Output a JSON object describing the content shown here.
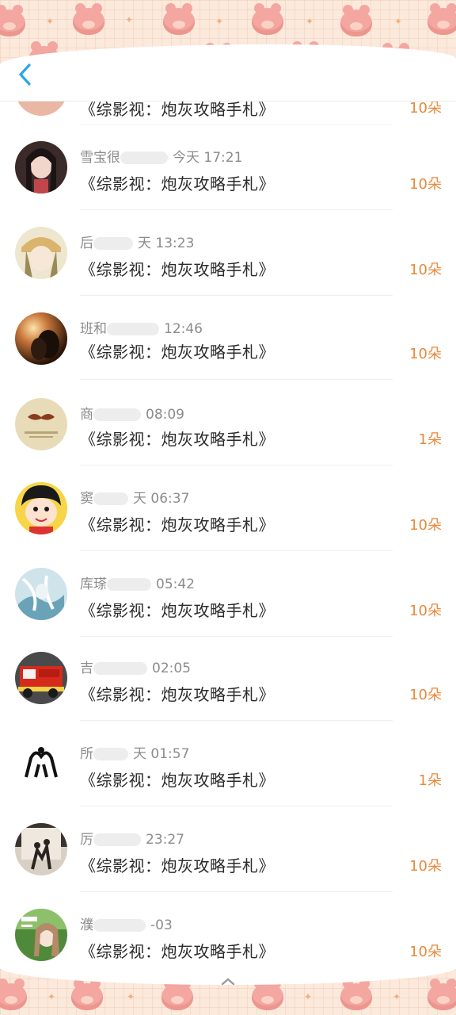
{
  "header": {
    "back_icon": "chevron-left-icon",
    "accent_color": "#2ba6e6"
  },
  "rows": [
    {
      "name": "",
      "time": "",
      "title": "《综影视：炮灰攻略手札》",
      "amount": "10朵"
    },
    {
      "name": "雪宝很",
      "time": "今天 17:21",
      "title": "《综影视：炮灰攻略手札》",
      "amount": "10朵"
    },
    {
      "name": "后",
      "time": "天 13:23",
      "title": "《综影视：炮灰攻略手札》",
      "amount": "10朵"
    },
    {
      "name": "班和",
      "time": "12:46",
      "title": "《综影视：炮灰攻略手札》",
      "amount": "10朵"
    },
    {
      "name": "商",
      "time": "08:09",
      "title": "《综影视：炮灰攻略手札》",
      "amount": "1朵"
    },
    {
      "name": "窦",
      "time": "天 06:37",
      "title": "《综影视：炮灰攻略手札》",
      "amount": "10朵"
    },
    {
      "name": "库瑹",
      "time": "05:42",
      "title": "《综影视：炮灰攻略手札》",
      "amount": "10朵"
    },
    {
      "name": "吉",
      "time": "02:05",
      "title": "《综影视：炮灰攻略手札》",
      "amount": "10朵"
    },
    {
      "name": "所",
      "time": "天 01:57",
      "title": "《综影视：炮灰攻略手札》",
      "amount": "1朵"
    },
    {
      "name": "厉",
      "time": "23:27",
      "title": "《综影视：炮灰攻略手札》",
      "amount": "10朵"
    },
    {
      "name": "濮",
      "time": "-03",
      "title": "《综影视：炮灰攻略手札》",
      "amount": "10朵"
    }
  ],
  "colors": {
    "amount": "#e78a3c",
    "meta_text": "#8c8c8c",
    "title_text": "#2b2b2b",
    "pattern_bg": "#fbe9dc"
  }
}
